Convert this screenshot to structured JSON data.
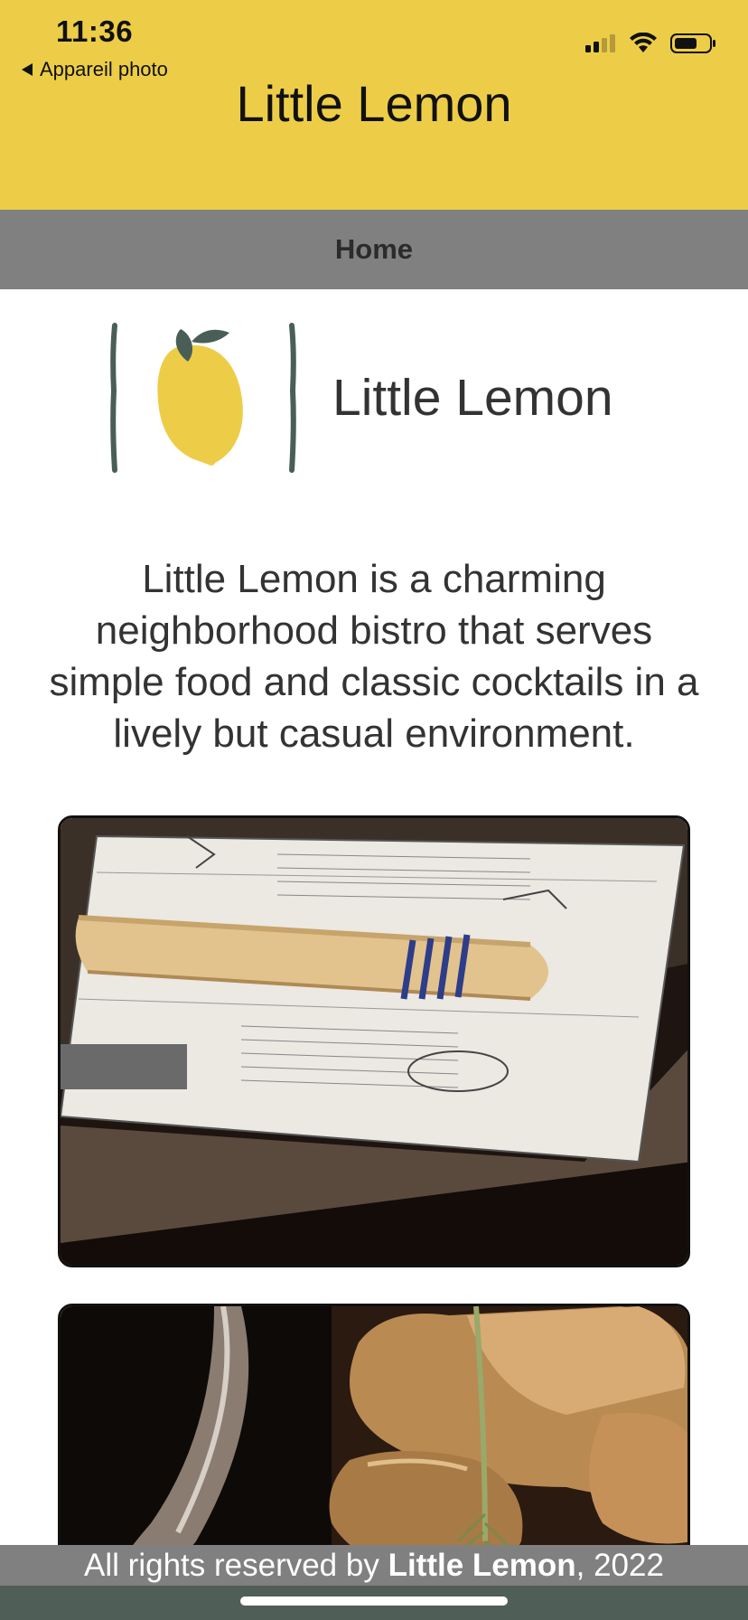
{
  "status_bar": {
    "time": "11:36",
    "back_label": "Appareil photo",
    "icons": [
      "signal-icon",
      "wifi-icon",
      "battery-icon"
    ]
  },
  "header": {
    "title": "Little Lemon"
  },
  "nav": {
    "home_label": "Home"
  },
  "logo": {
    "brand_name": "Little Lemon",
    "icon": "lemon-logo"
  },
  "main": {
    "description": "Little Lemon is a charming neighborhood bistro that serves simple food and classic cocktails in a lively but casual environment."
  },
  "footer": {
    "prefix": "All rights reserved by ",
    "brand": "Little Lemon",
    "suffix": ", 2022"
  },
  "colors": {
    "header_bg": "#EDCD48",
    "nav_bg": "#808080",
    "footer_bg": "#808080",
    "bottom_bar": "#4F5E56",
    "logo_leaf": "#495E57",
    "lemon": "#EDCD48"
  }
}
